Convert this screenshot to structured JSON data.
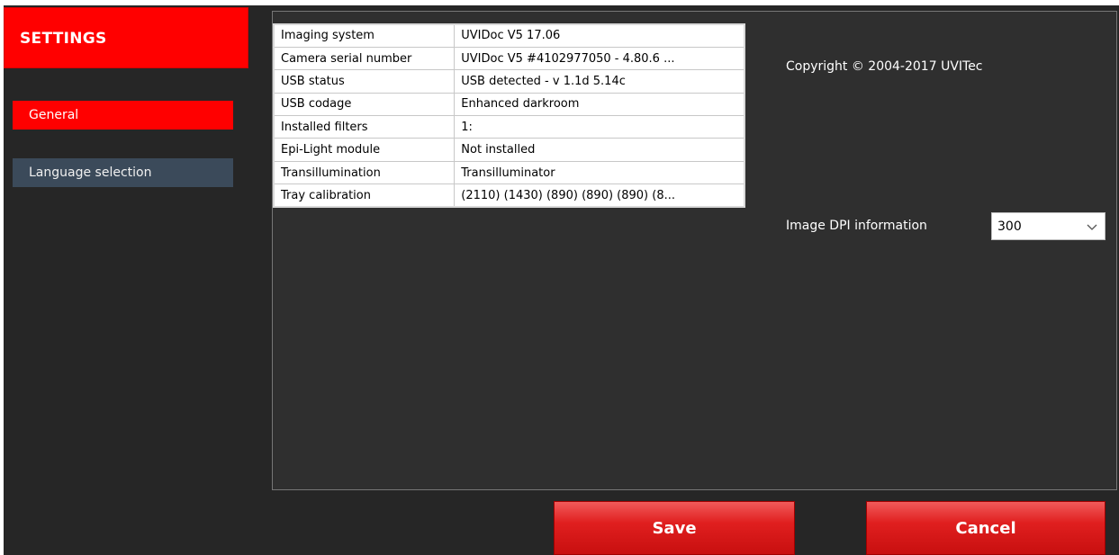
{
  "sidebar": {
    "header": "SETTINGS",
    "items": [
      {
        "label": "General",
        "active": true
      },
      {
        "label": "Language selection",
        "active": false
      }
    ]
  },
  "info_table": [
    {
      "key": "Imaging system",
      "value": "UVIDoc V5 17.06"
    },
    {
      "key": "Camera serial number",
      "value": "UVIDoc V5 #4102977050  - 4.80.6 ..."
    },
    {
      "key": "USB status",
      "value": "USB detected - v 1.1d 5.14c"
    },
    {
      "key": "USB codage",
      "value": "Enhanced darkroom"
    },
    {
      "key": "Installed filters",
      "value": " 1:"
    },
    {
      "key": "Epi-Light module",
      "value": "Not installed"
    },
    {
      "key": "Transillumination",
      "value": "Transilluminator"
    },
    {
      "key": "Tray calibration",
      "value": " (2110) (1430) (890) (890) (890) (8..."
    }
  ],
  "copyright": "Copyright © 2004-2017 UVITec",
  "dpi": {
    "label": "Image DPI information",
    "selected": "300",
    "icon": "chevron-down-icon"
  },
  "buttons": {
    "save": "Save",
    "cancel": "Cancel"
  },
  "colors": {
    "accent": "#ff0000",
    "background": "#262626",
    "inactive_item": "#3b4a5a"
  }
}
